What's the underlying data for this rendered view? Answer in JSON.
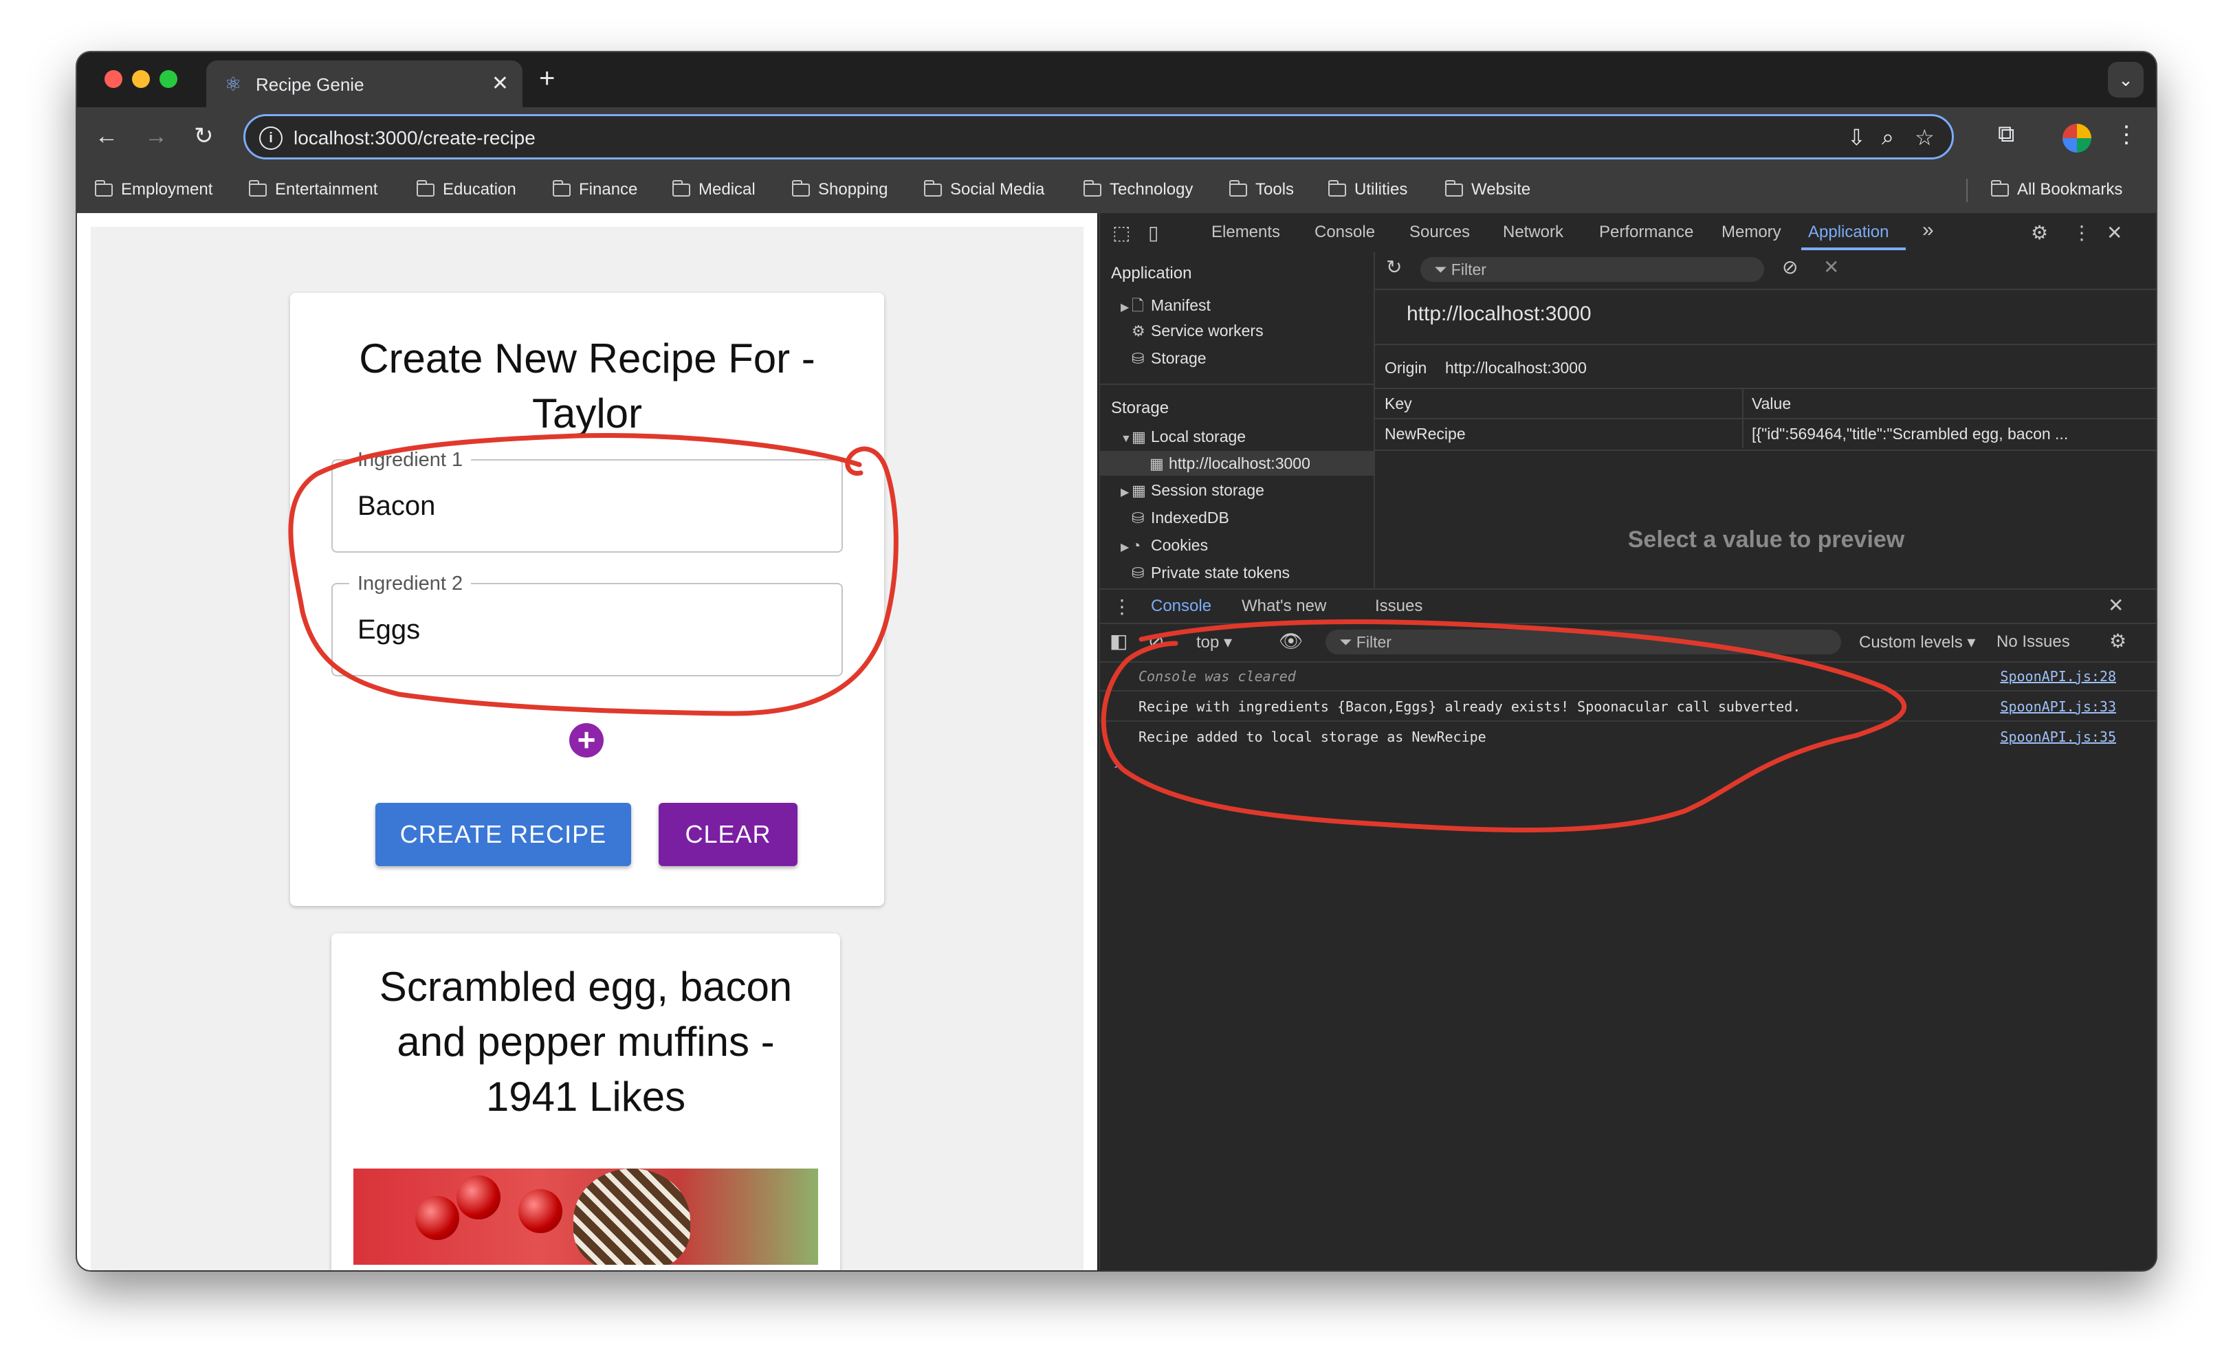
{
  "browser": {
    "tab_title": "Recipe Genie",
    "tab_close": "✕",
    "new_tab": "+",
    "url": "localhost:3000/create-recipe",
    "bookmarks": [
      "Employment",
      "Entertainment",
      "Education",
      "Finance",
      "Medical",
      "Shopping",
      "Social Media",
      "Technology",
      "Tools",
      "Utilities",
      "Website"
    ],
    "all_bookmarks": "All Bookmarks"
  },
  "page": {
    "form_title": "Create New Recipe For - Taylor",
    "ingredients": [
      {
        "label": "Ingredient 1",
        "value": "Bacon"
      },
      {
        "label": "Ingredient 2",
        "value": "Eggs"
      }
    ],
    "add_icon": "+",
    "create_button": "CREATE RECIPE",
    "clear_button": "CLEAR",
    "recipe_title": "Scrambled egg, bacon and pepper muffins - 1941 Likes"
  },
  "devtools": {
    "tabs": [
      "Elements",
      "Console",
      "Sources",
      "Network",
      "Performance",
      "Memory",
      "Application"
    ],
    "active_tab": "Application",
    "more_tabs": "»",
    "sidebar": {
      "application_header": "Application",
      "application_items": [
        "Manifest",
        "Service workers",
        "Storage"
      ],
      "storage_header": "Storage",
      "storage_items": [
        "Local storage",
        "http://localhost:3000",
        "Session storage",
        "IndexedDB",
        "Cookies",
        "Private state tokens"
      ]
    },
    "filter_placeholder": "Filter",
    "origin_url": "http://localhost:3000",
    "origin_label": "Origin",
    "origin_value": "http://localhost:3000",
    "table_headers": [
      "Key",
      "Value"
    ],
    "table_rows": [
      {
        "key": "NewRecipe",
        "value": "[{\"id\":569464,\"title\":\"Scrambled egg, bacon ..."
      }
    ],
    "preview_text": "Select a value to preview",
    "drawer_tabs": [
      "Console",
      "What's new",
      "Issues"
    ],
    "console": {
      "context": "top",
      "filter_placeholder": "Filter",
      "levels": "Custom levels",
      "issues": "No Issues",
      "messages": [
        {
          "text": "Console was cleared",
          "link": "SpoonAPI.js:28"
        },
        {
          "text": "Recipe with ingredients {Bacon,Eggs} already exists! Spoonacular call subverted.",
          "link": "SpoonAPI.js:33"
        },
        {
          "text": "Recipe added to local storage as NewRecipe",
          "link": "SpoonAPI.js:35"
        }
      ],
      "prompt": "›"
    }
  },
  "colors": {
    "accent_blue": "#3b78d6",
    "accent_purple": "#7b1fa2",
    "annotation_red": "#e0392b",
    "devtools_active": "#7cacf8"
  },
  "icons": [
    "back-arrow-icon",
    "forward-arrow-icon",
    "reload-icon",
    "info-icon",
    "install-icon",
    "zoom-icon",
    "star-icon",
    "extensions-icon",
    "kebab-menu-icon",
    "folder-icon",
    "react-icon",
    "gear-icon",
    "close-icon",
    "inspect-icon",
    "device-icon",
    "eye-icon",
    "block-icon",
    "funnel-icon"
  ]
}
